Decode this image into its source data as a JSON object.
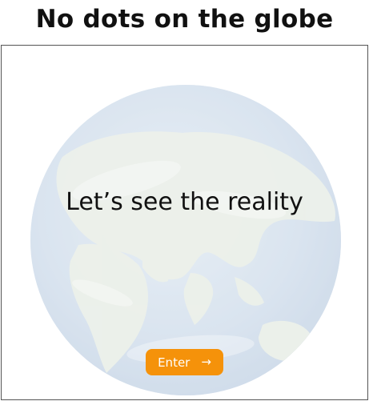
{
  "page": {
    "heading": "No dots on the globe"
  },
  "hero": {
    "tagline": "Let’s see the reality"
  },
  "enter_button": {
    "label": "Enter",
    "icon": "arrow-right-icon",
    "color": "#f5920a"
  },
  "colors": {
    "ocean": "#c9d8e8",
    "land": "#dfe6dc",
    "frame_border": "#555555"
  }
}
